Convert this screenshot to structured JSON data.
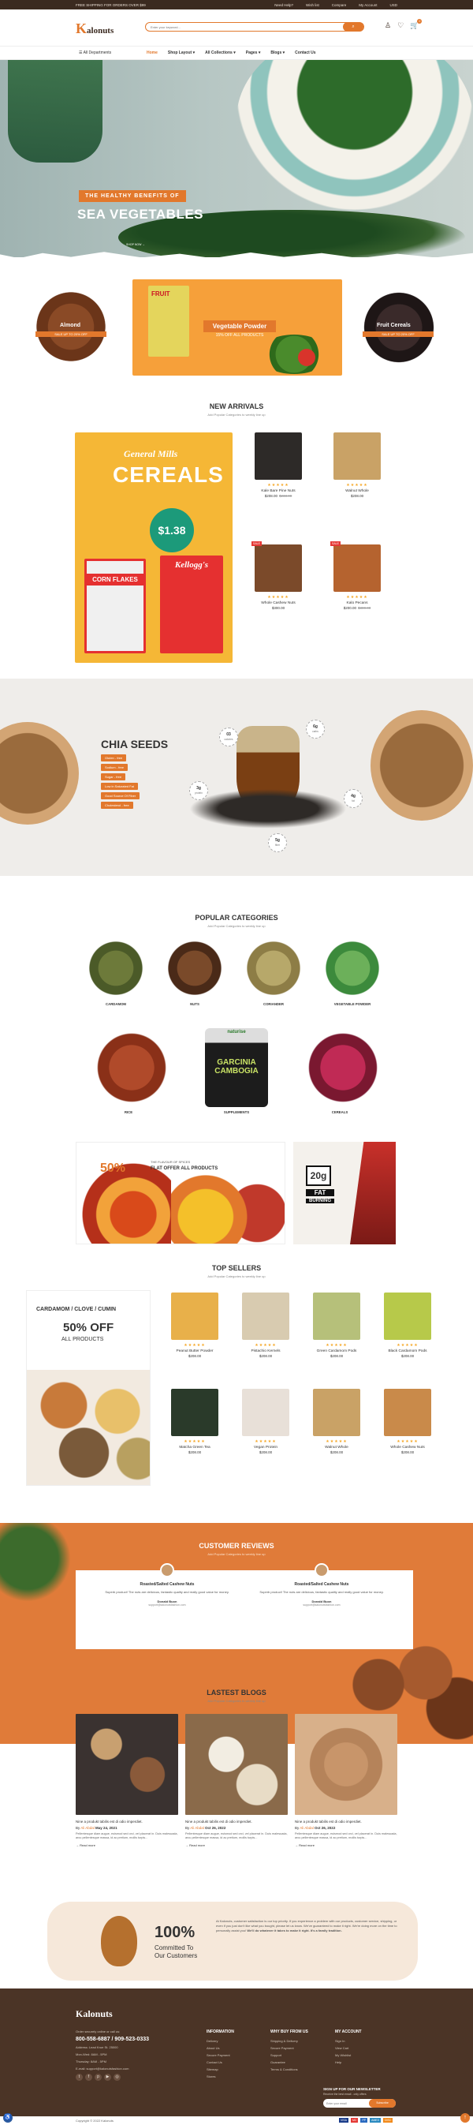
{
  "topbar": {
    "promo": "FREE SHIPPING FOR ORDERS OVER $99",
    "links": [
      "Need Help?",
      "Wish list",
      "Compare",
      "My Account",
      "USD"
    ]
  },
  "header": {
    "logo_mark": "K",
    "logo_text": "alonuts",
    "search_placeholder": "Enter your keyword...",
    "search_icon": "search-icon",
    "icons": [
      "user-icon",
      "heart-icon",
      "cart-icon"
    ],
    "cart_count": "0"
  },
  "nav": {
    "all_departments": "All Departments",
    "items": [
      {
        "label": "Home",
        "active": true
      },
      {
        "label": "Shop Layout ▾",
        "active": false
      },
      {
        "label": "All Collections ▾",
        "active": false
      },
      {
        "label": "Pages ▾",
        "active": false
      },
      {
        "label": "Blogs ▾",
        "active": false
      },
      {
        "label": "Contact Us",
        "active": false
      }
    ]
  },
  "hero": {
    "tag": "THE HEALTHY BENEFITS OF",
    "title": "SEA VEGETABLES",
    "cta": "SHOP NOW →"
  },
  "banners": [
    {
      "title": "Almond",
      "sub": "SALE UP TO 20% OFF"
    },
    {
      "title": "Vegetable Powder",
      "sub": "15% OFF ALL PRODUCTS",
      "pack_text": "FRUIT"
    },
    {
      "title": "Fruit Cereals",
      "sub": "SALE UP TO 20% OFF"
    }
  ],
  "new_arrivals": {
    "title": "NEW ARRIVALS",
    "subtitle": "Add Popular Categories to weekly line up",
    "promo": {
      "line1": "General Mills",
      "line2": "CEREALS",
      "price": "$1.38",
      "box1": "CORN FLAKES",
      "box2": "Kellogg's"
    },
    "products": [
      {
        "name": "Kale Bare Pine Nuts",
        "price": "$208.00",
        "old": "$233.00",
        "badge": ""
      },
      {
        "name": "Walnut Whole",
        "price": "$208.00",
        "old": "",
        "badge": ""
      },
      {
        "name": "Whole Cashew Nuts",
        "price": "$300.00",
        "old": "",
        "badge": "SALE"
      },
      {
        "name": "Kalo Pecans",
        "price": "$200.00",
        "old": "$300.00",
        "badge": "SALE"
      }
    ]
  },
  "chia": {
    "title": "CHIA SEEDS",
    "chips": [
      "Gluten - free",
      "Sodium - free",
      "Sugar - free",
      "Low in Saturated Fat",
      "Good Source Of Fiber",
      "Cholesterol - free"
    ],
    "nutrients": [
      {
        "value": "03",
        "label": "calories"
      },
      {
        "value": "6g",
        "label": "carbs"
      },
      {
        "value": "3g",
        "label": "protein"
      },
      {
        "value": "4g",
        "label": "fat"
      },
      {
        "value": "5g",
        "label": "fiber"
      }
    ]
  },
  "popular": {
    "title": "POPULAR CATEGORIES",
    "subtitle": "Add Popular Categories to weekly line up",
    "items": [
      "CARDAMOM",
      "NUTS",
      "CORIANDER",
      "VEGETABLE POWDER",
      "RICE",
      "SUPPLEMENTS",
      "CEREALS"
    ],
    "jar_brand": "naturise",
    "jar_text": "GARCINIA CAMBOGIA"
  },
  "promo_banners": {
    "spices": {
      "pct": "50%",
      "line1": "THE FLAVOUR OF SPICES",
      "line2": "FLAT OFFER ALL PRODUCTS"
    },
    "fat": {
      "big": "20g",
      "line1": "FAT",
      "line2": "BURNING"
    }
  },
  "top_sellers": {
    "title": "TOP SELLERS",
    "subtitle": "Add Popular Categories to weekly line up",
    "promo": {
      "line1": "CARDAMOM / CLOVE / CUMIN",
      "line2": "50% OFF",
      "line3": "ALL PRODUCTS"
    },
    "products": [
      {
        "name": "Peanut Butter Powder",
        "price": "$208.00",
        "old": ""
      },
      {
        "name": "Pistachio Kernels",
        "price": "$208.00",
        "old": ""
      },
      {
        "name": "Green Cardamom Pods",
        "price": "$208.00",
        "old": ""
      },
      {
        "name": "Black Cardamom Pods",
        "price": "$208.00",
        "old": ""
      },
      {
        "name": "Matcha Green Tea",
        "price": "$208.00",
        "old": ""
      },
      {
        "name": "Vegan Protein",
        "price": "$208.00",
        "old": ""
      },
      {
        "name": "Walnut Whole",
        "price": "$208.00",
        "old": ""
      },
      {
        "name": "Whole Cashew Nuts",
        "price": "$208.00",
        "old": ""
      }
    ]
  },
  "reviews": {
    "title": "CUSTOMER REVIEWS",
    "subtitle": "Add Popular Categories to weekly line up",
    "items": [
      {
        "title": "Roasted/Salted Cashew Nuts",
        "text": "Superb product! The nuts are delicious, fantastic quality and really good value for money.",
        "name": "Donald Buon",
        "email": "support@kalonutsfashion.com"
      },
      {
        "title": "Roasted/Salted Cashew Nuts",
        "text": "Superb product! The nuts are delicious, fantastic quality and really good value for money.",
        "name": "Donald Buon",
        "email": "support@kalonutsfashion.com"
      }
    ]
  },
  "blogs": {
    "title": "LASTEST BLOGS",
    "subtitle": "Add Popular Categories to weekly line up",
    "items": [
      {
        "title": "Nine a produkt tabilis est di odio imperdiet.",
        "by": "Ali Abdal",
        "date": "May 24, 2021",
        "text": "Pellentesque diam augue, euismod sed orci, vel placerat in. Duis malesuada, arcu pellentesque massa, id ac pretium, mollis turpis...",
        "more": "Read more"
      },
      {
        "title": "Nine a produkt tabilis est di odio imperdiet.",
        "by": "Ali Abdal",
        "date": "Oct 26, 2022",
        "text": "Pellentesque diam augue, euismod sed orci, vel placerat in. Duis malesuada, arcu pellentesque massa, id ac pretium, mollis turpis...",
        "more": "Read more"
      },
      {
        "title": "Nine a produkt tabilis est di odio imperdiet.",
        "by": "Ali Abdal",
        "date": "Oct 26, 2022",
        "text": "Pellentesque diam augue, euismod sed orci, vel placerat in. Duis malesuada, arcu pellentesque massa, id ac pretium, mollis turpis...",
        "more": "Read more"
      }
    ]
  },
  "committed": {
    "pct": "100%",
    "line1": "Committed To",
    "line2": "Our Customers",
    "text": "At Kalonuts, customer satisfaction is our top priority. If you experience a problem with our products, customer service, shipping, or even if you just don't like what you bought, please let us know. We've guaranteed to make it right. We're doing more on the time to personally assist you!",
    "bold": "We'll do whatever it takes to make it right. It's a family tradition."
  },
  "footer": {
    "logo": "Kalonuts",
    "contact": {
      "intro": "Order securely online or call us:",
      "phone": "800-558-6887 / 909-523-0333",
      "address": "Address: Lead Krue St. 25000",
      "hours1": "Mon-Wed: 8AM - 5PM",
      "hours2": "Thursday: 8AM - 5PM",
      "email": "E-mail: support@kalonutsfashion.com"
    },
    "columns": [
      {
        "title": "INFORMATION",
        "links": [
          "Delivery",
          "About Us",
          "Secure Payment",
          "Contact Us",
          "Sitemap",
          "Stores"
        ]
      },
      {
        "title": "WHY BUY FROM US",
        "links": [
          "Shipping & Delivery",
          "Secure Payment",
          "Support",
          "Guarantee",
          "Terms & Conditions"
        ]
      },
      {
        "title": "MY ACCOUNT",
        "links": [
          "Sign In",
          "View Cart",
          "My Wishlist",
          "Help"
        ]
      }
    ],
    "newsletter": {
      "title": "SIGN UP FOR OUR NEWSLETTER",
      "sub": "Receive the best email - only offers",
      "placeholder": "Enter your email",
      "button": "Subscribe"
    },
    "socials": [
      "twitter-icon",
      "facebook-icon",
      "pinterest-icon",
      "youtube-icon",
      "instagram-icon"
    ]
  },
  "copyright": "Copyright © 2022 Kalonuts",
  "payments": [
    "VISA",
    "MC",
    "PP",
    "AMEX",
    "DISC"
  ],
  "colors": {
    "accent": "#e2782c",
    "dark": "#3b2a20",
    "footer": "#4b3426",
    "reviews_bg": "#e07b39"
  }
}
